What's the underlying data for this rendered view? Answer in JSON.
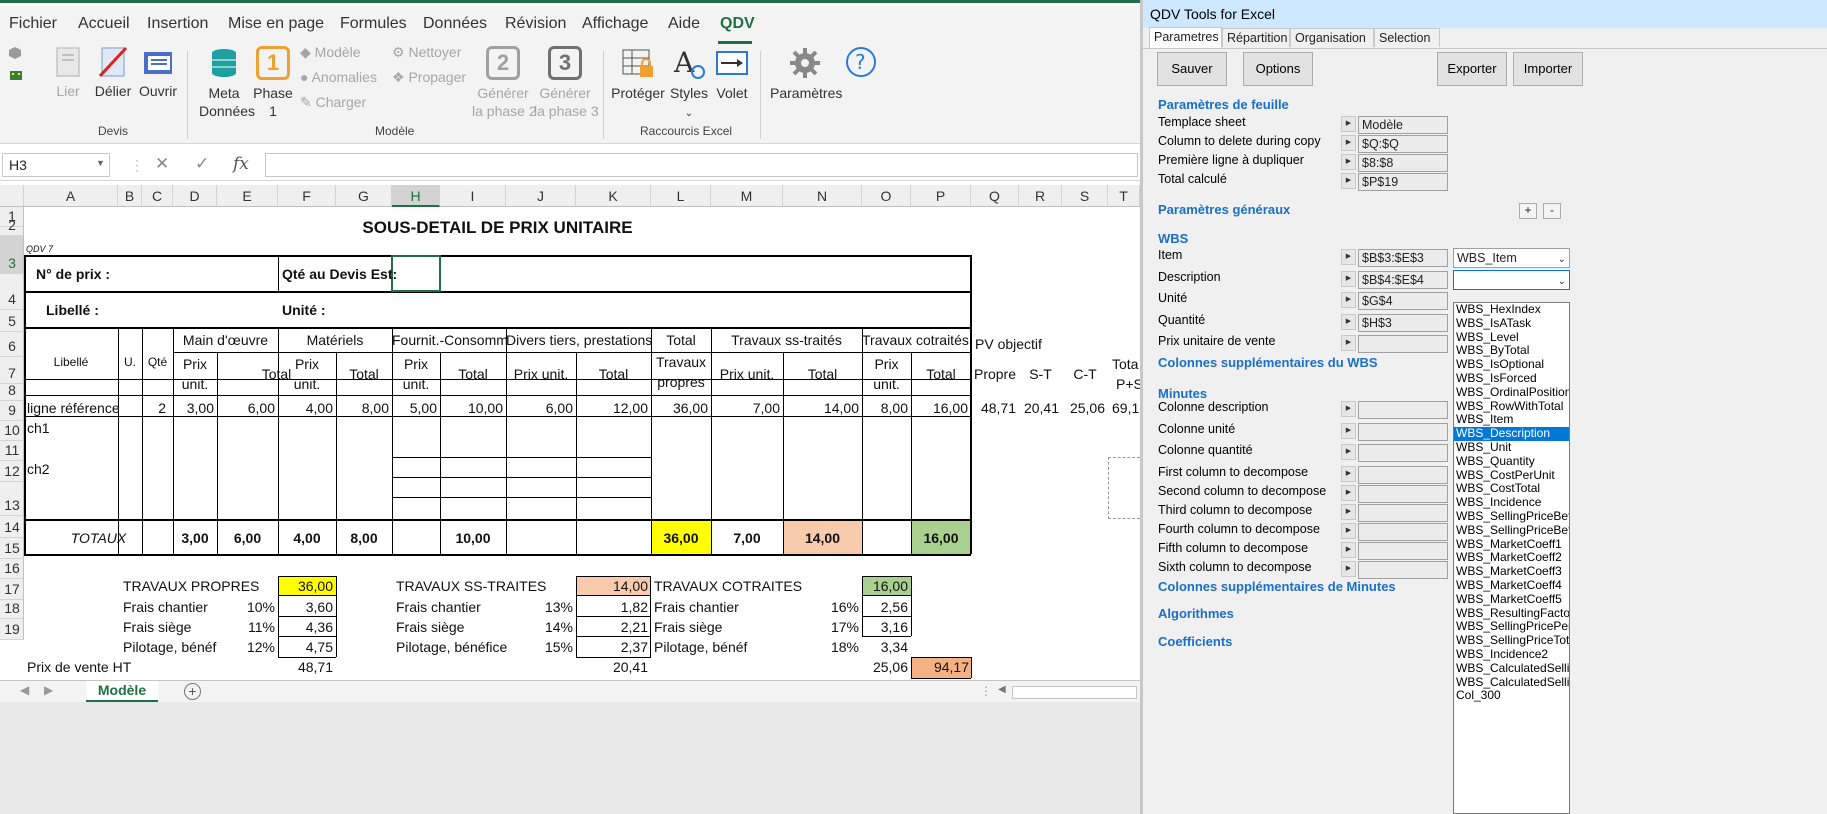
{
  "menu": {
    "items": [
      "Fichier",
      "Accueil",
      "Insertion",
      "Mise en page",
      "Formules",
      "Données",
      "Révision",
      "Affichage",
      "Aide",
      "QDV"
    ]
  },
  "ribbon": {
    "devis": {
      "lier": "Lier",
      "delier": "Délier",
      "ouvrir": "Ouvrir",
      "group": "Devis"
    },
    "modele": {
      "meta1": "Meta",
      "meta2": "Données",
      "phase1a": "Phase",
      "phase1b": "1",
      "phase_icon_num": "1",
      "modele": "Modèle",
      "anomalies": "Anomalies",
      "charger": "Charger",
      "nettoyer": "Nettoyer",
      "propager": "Propager",
      "gen2a": "Générer",
      "gen2b": "la phase 2",
      "gen2_num": "2",
      "gen3a": "Générer",
      "gen3b": "la phase 3",
      "gen3_num": "3",
      "group": "Modèle"
    },
    "raccourcis": {
      "proteger": "Protéger",
      "styles": "Styles",
      "volet": "Volet",
      "group": "Raccourcis Excel"
    },
    "parametres": "Paramètres"
  },
  "formulabar": {
    "namebox": "H3",
    "cancel": "✕",
    "enter": "✓",
    "fx": "fx"
  },
  "grid": {
    "cols": [
      "A",
      "B",
      "C",
      "D",
      "E",
      "F",
      "G",
      "H",
      "I",
      "J",
      "K",
      "L",
      "M",
      "N",
      "O",
      "P",
      "Q",
      "R",
      "S",
      "T"
    ],
    "rows": [
      "1",
      "2",
      "3",
      "4",
      "5",
      "6",
      "7",
      "8",
      "9",
      "10",
      "11",
      "12",
      "13",
      "14",
      "15",
      "16",
      "17",
      "18",
      "19"
    ],
    "title": "SOUS-DETAIL DE PRIX UNITAIRE",
    "qdv": "QDV 7",
    "no_prix": "N° de prix :",
    "qte_devis": "Qté au Devis Est:",
    "libelle": "Libellé :",
    "unite": "Unité :",
    "h_libelle": "Libellé",
    "h_u": "U.",
    "h_qte": "Qté",
    "h_main": "Main d'œuvre",
    "h_mat": "Matériels",
    "h_fourn": "Fournit.-Consomm",
    "h_divers": "Divers tiers, prestations",
    "h_total_trav1": "Total",
    "h_total_trav2": "Travaux",
    "h_total_trav3": "propres",
    "h_ss": "Travaux ss-traités",
    "h_cot": "Travaux cotraités",
    "h_pv": "PV objectif",
    "h_pu1": "Prix",
    "h_pu2": "unit.",
    "h_total": "Total",
    "h_prixunit": "Prix unit.",
    "h_propre": "Propre",
    "h_st": "S-T",
    "h_ct": "C-T",
    "h_tot1": "Tota",
    "h_tot2": "P+S",
    "r8": {
      "label": "ligne référence",
      "qte": "2",
      "d": "3,00",
      "e": "6,00",
      "f": "4,00",
      "g": "8,00",
      "h": "5,00",
      "i": "10,00",
      "j": "6,00",
      "k": "12,00",
      "l": "36,00",
      "m": "7,00",
      "n": "14,00",
      "o": "8,00",
      "p": "16,00",
      "q": "48,71",
      "r": "20,41",
      "s": "25,06",
      "t": "69,1"
    },
    "ch1": "ch1",
    "ch2": "ch2",
    "totaux": {
      "label": "TOTAUX",
      "d": "3,00",
      "e": "6,00",
      "f": "4,00",
      "g": "8,00",
      "i": "10,00",
      "l": "36,00",
      "m": "7,00",
      "n": "14,00",
      "p": "16,00"
    },
    "summary": {
      "tp": "TRAVAUX PROPRES",
      "tp_val": "36,00",
      "tss": "TRAVAUX SS-TRAITES",
      "tss_val": "14,00",
      "tc": "TRAVAUX COTRAITES",
      "tc_val": "16,00",
      "fc": "Frais chantier",
      "fs": "Frais siège",
      "pb": "Pilotage, bénéf",
      "pb2": "Pilotage, bénéfice",
      "p16a": "10%",
      "v16a": "3,60",
      "p16b": "13%",
      "v16b": "1,82",
      "p16c": "16%",
      "v16c": "2,56",
      "p17a": "11%",
      "v17a": "4,36",
      "p17b": "14%",
      "v17b": "2,21",
      "p17c": "17%",
      "v17c": "3,16",
      "p18a": "12%",
      "v18a": "4,75",
      "p18b": "15%",
      "v18b": "2,37",
      "p18c": "18%",
      "v18c": "3,34",
      "pv": "Prix de vente HT",
      "pv_a": "48,71",
      "pv_b": "20,41",
      "pv_c": "25,06",
      "pv_total": "94,17"
    }
  },
  "sheet_tab": "Modèle",
  "panel": {
    "title": "QDV Tools for Excel",
    "tabs": [
      "Parametres",
      "Répartition",
      "Organisation",
      "Selection"
    ],
    "btn_sauver": "Sauver",
    "btn_options": "Options",
    "btn_exporter": "Exporter",
    "btn_importer": "Importer",
    "sec_feuille": "Paramètres de feuille",
    "feuille": [
      {
        "label": "Templace sheet",
        "value": "Modèle"
      },
      {
        "label": "Column to delete during copy",
        "value": "$Q:$Q"
      },
      {
        "label": "Première ligne à dupliquer",
        "value": "$8:$8"
      },
      {
        "label": "Total calculé",
        "value": "$P$19"
      }
    ],
    "sec_generaux": "Paramètres généraux",
    "plus": "+",
    "minus": "-",
    "sec_wbs": "WBS",
    "wbs": [
      {
        "label": "Item",
        "value": "$B$3:$E$3"
      },
      {
        "label": "Description",
        "value": "$B$4:$E$4"
      },
      {
        "label": "Unité",
        "value": "$G$4"
      },
      {
        "label": "Quantité",
        "value": "$H$3"
      },
      {
        "label": "Prix unitaire de vente",
        "value": ""
      }
    ],
    "combo_item": "WBS_Item",
    "combo_desc": "",
    "sec_wbs_extra": "Colonnes supplémentaires du WBS",
    "sec_minutes": "Minutes",
    "minutes": [
      "Colonne description",
      "Colonne unité",
      "Colonne quantité",
      "First column to decompose",
      "Second column to decompose",
      "Third column to decompose",
      "Fourth column to decompose",
      "Fifth column to decompose",
      "Sixth column to decompose"
    ],
    "sec_minutes_extra": "Colonnes supplémentaires de Minutes",
    "sec_algo": "Algorithmes",
    "sec_coef": "Coefficients",
    "list": [
      "WBS_HexIndex",
      "WBS_IsATask",
      "WBS_Level",
      "WBS_ByTotal",
      "WBS_IsOptional",
      "WBS_IsForced",
      "WBS_OrdinalPosition",
      "WBS_RowWithTotal",
      "WBS_Item",
      "WBS_Description",
      "WBS_Unit",
      "WBS_Quantity",
      "WBS_CostPerUnit",
      "WBS_CostTotal",
      "WBS_Incidence",
      "WBS_SellingPriceBefo",
      "WBS_SellingPriceBefo",
      "WBS_MarketCoeff1",
      "WBS_MarketCoeff2",
      "WBS_MarketCoeff3",
      "WBS_MarketCoeff4",
      "WBS_MarketCoeff5",
      "WBS_ResultingFactor",
      "WBS_SellingPricePeru",
      "WBS_SellingPriceTota",
      "WBS_Incidence2",
      "WBS_CalculatedSellin",
      "WBS_CalculatedSellin",
      "Col_300"
    ],
    "list_selected": "WBS_Description"
  },
  "colors": {
    "yellow": "#ffff00",
    "salmon": "#f8cbad",
    "green": "#a9d08e",
    "orange": "#f4b183",
    "accent": "#1e7145"
  }
}
